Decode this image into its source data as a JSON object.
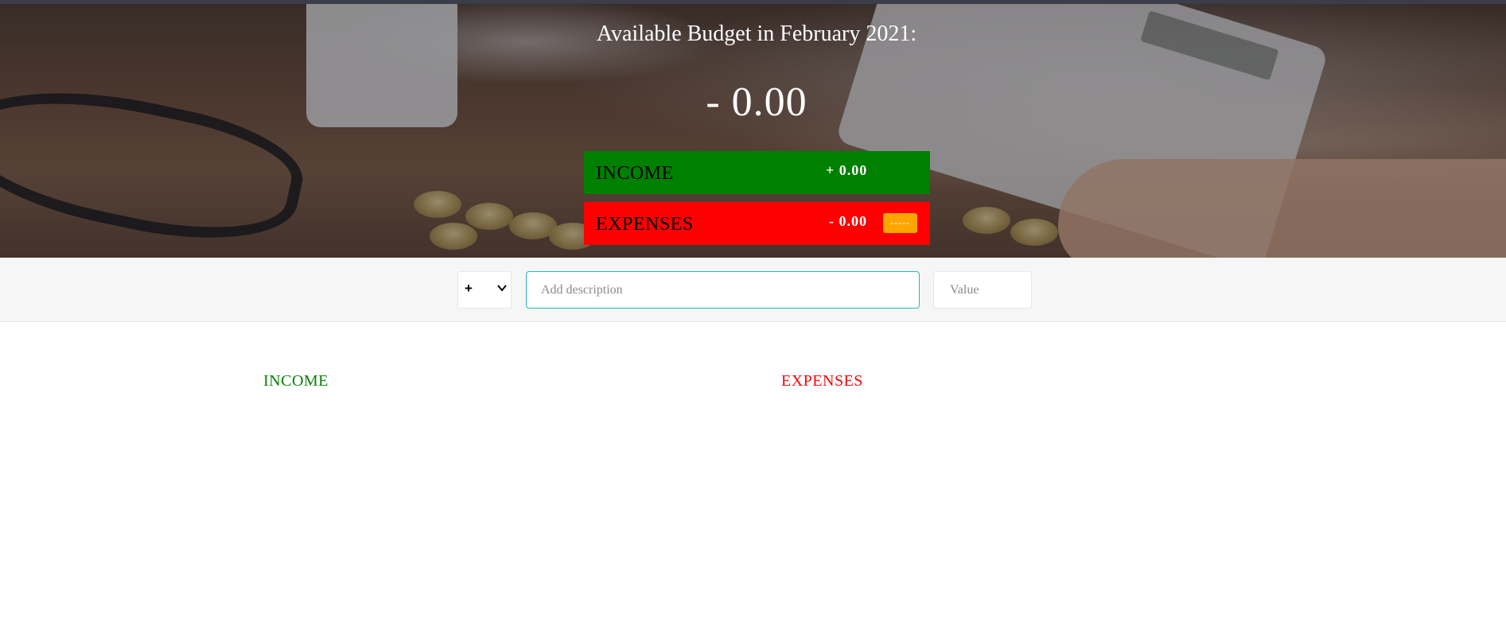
{
  "header": {
    "budget_title": "Available Budget in February 2021:",
    "budget_value": "- 0.00"
  },
  "summary": {
    "income": {
      "label": "INCOME",
      "value": "+ 0.00",
      "color": "#008000"
    },
    "expenses": {
      "label": "EXPENSES",
      "value": "- 0.00",
      "percentage": "-----",
      "color": "#ff0000",
      "badge_color": "#ffa500"
    }
  },
  "add_form": {
    "type_selected": "+",
    "type_options": [
      "+",
      "-"
    ],
    "description_placeholder": "Add description",
    "value_placeholder": "Value",
    "focus_color": "#28b9b5"
  },
  "lists": {
    "income_title": "INCOME",
    "expenses_title": "EXPENSES"
  }
}
